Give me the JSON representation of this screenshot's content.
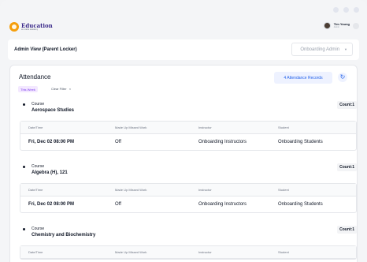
{
  "app": {
    "logo_title": "Education",
    "logo_subtitle": "an oracle academy"
  },
  "user": {
    "name": "Tim Young",
    "role": "Admin"
  },
  "admin_bar": {
    "title": "Admin View (Parent Locker)",
    "select_value": "Onboarding Admin"
  },
  "attendance": {
    "title": "Attendance",
    "records_button": "4 Attendance Records",
    "filter_chip": "This Week",
    "clear_filter": "Clear Filter",
    "clear_icon": "×",
    "course_label": "Course",
    "columns": [
      "Date/Time",
      "Made Up Missed Work",
      "Instructor",
      "Student"
    ],
    "courses": [
      {
        "name": "Aerospace Studies",
        "count": "Count:1",
        "rows": [
          [
            "Fri, Dec 02 08:00 PM",
            "Off",
            "Onboarding Instructors",
            "Onboarding Students"
          ]
        ]
      },
      {
        "name": "Algebra (H), 121",
        "count": "Count:1",
        "rows": [
          [
            "Fri, Dec 02 08:00 PM",
            "Off",
            "Onboarding Instructors",
            "Onboarding Students"
          ]
        ]
      },
      {
        "name": "Chemistry and Biochemistry",
        "count": "Count:1",
        "rows": []
      }
    ]
  },
  "colors": {
    "accent": "#2563eb",
    "filter": "#7c3aed",
    "logo": "#f59e0b"
  }
}
